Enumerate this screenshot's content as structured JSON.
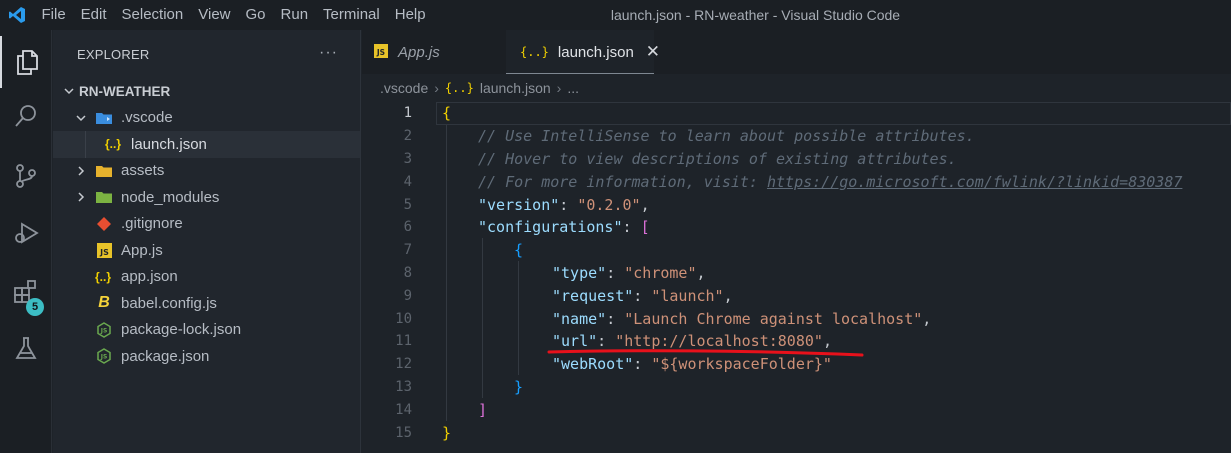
{
  "menu": [
    "File",
    "Edit",
    "Selection",
    "View",
    "Go",
    "Run",
    "Terminal",
    "Help"
  ],
  "window_title": "launch.json - RN-weather - Visual Studio Code",
  "activity_badge": "5",
  "explorer": {
    "title": "EXPLORER",
    "more": "···",
    "root": "RN-WEATHER",
    "items": [
      {
        "label": ".vscode",
        "icon": "vscode-folder-icon"
      },
      {
        "label": "launch.json",
        "icon": "json-icon"
      },
      {
        "label": "assets",
        "icon": "folder-icon"
      },
      {
        "label": "node_modules",
        "icon": "folder-icon"
      },
      {
        "label": ".gitignore",
        "icon": "git-icon"
      },
      {
        "label": "App.js",
        "icon": "js-icon"
      },
      {
        "label": "app.json",
        "icon": "json-icon"
      },
      {
        "label": "babel.config.js",
        "icon": "babel-icon"
      },
      {
        "label": "package-lock.json",
        "icon": "node-icon"
      },
      {
        "label": "package.json",
        "icon": "node-icon"
      }
    ]
  },
  "tabs": [
    {
      "label": "App.js",
      "icon_text": "JS"
    },
    {
      "label": "launch.json",
      "icon_text": "{..}",
      "close": "✕"
    }
  ],
  "breadcrumb": [
    ".vscode",
    "launch.json",
    "..."
  ],
  "code": {
    "line_numbers": [
      "1",
      "2",
      "3",
      "4",
      "5",
      "6",
      "7",
      "8",
      "9",
      "10",
      "11",
      "12",
      "13",
      "14",
      "15"
    ],
    "l1": "{",
    "l2": "// Use IntelliSense to learn about possible attributes.",
    "l3": "// Hover to view descriptions of existing attributes.",
    "l4_pre": "// For more information, visit: ",
    "l4_link": "https://go.microsoft.com/fwlink/?linkid=830387",
    "l5_key": "\"version\"",
    "l5_val": "\"0.2.0\"",
    "l6_key": "\"configurations\"",
    "l6_open": "[",
    "l7": "{",
    "l8_key": "\"type\"",
    "l8_val": "\"chrome\"",
    "l9_key": "\"request\"",
    "l9_val": "\"launch\"",
    "l10_key": "\"name\"",
    "l10_val": "\"Launch Chrome against localhost\"",
    "l11_key": "\"url\"",
    "l11_val": "\"http://localhost:8080\"",
    "l12_key": "\"webRoot\"",
    "l12_val": "\"${workspaceFolder}\"",
    "l13": "}",
    "l14": "]",
    "l15": "}",
    "colon": ": ",
    "comma": ","
  },
  "colors": {
    "annotation": "#e8111b",
    "json_brace": "#f1d000",
    "folder_blue": "#4a9ee8"
  }
}
